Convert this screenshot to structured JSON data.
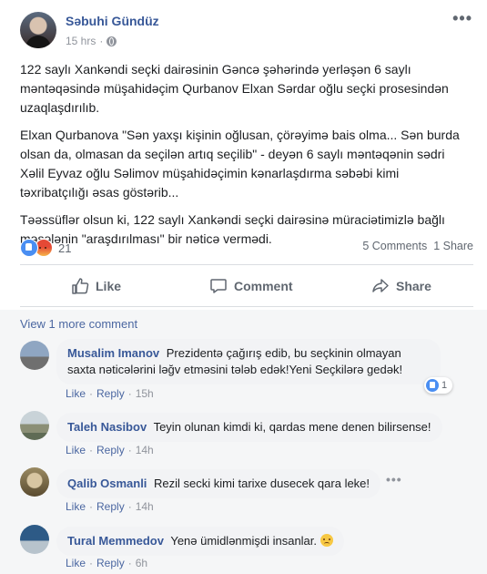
{
  "post": {
    "author": "Səbuhi Gündüz",
    "time": "15 hrs",
    "more_label": "•••",
    "paragraphs": [
      "122 saylı Xankəndi seçki dairəsinin Gəncə şəhərində yerləşən 6 saylı məntəqəsində müşahidəçim Qurbanov Elxan Sərdar oğlu seçki prosesindən uzaqlaşdırılıb.",
      "Elxan Qurbanova \"Sən yaxşı kişinin oğlusan, çörəyimə bais olma... Sən burda olsan da, olmasan da seçilən artıq seçilib\" - deyən 6 saylı məntəqənin sədri Xəlil Eyvaz oğlu Səlimov müşahidəçimin kənarlaşdırma səbəbi kimi təxribatçılığı əsas göstərib...",
      "Təəssüflər olsun ki, 122 saylı Xankəndi seçki dairəsinə müraciətimizlə bağlı məsələnin \"araşdırılması\" bir nəticə vermədi."
    ],
    "reaction_count": "21",
    "comments_count": "5 Comments",
    "shares_count": "1 Share"
  },
  "actions": {
    "like": "Like",
    "comment": "Comment",
    "share": "Share"
  },
  "comments_section": {
    "view_more": "View 1 more comment",
    "items": [
      {
        "name": "Musalim Imanov",
        "text": "Prezidentə çağırış edib, bu seçkinin olmayan saxta nəticələrini ləğv etməsini tələb edək!Yeni Seçkilərə gedək!",
        "like": "Like",
        "reply": "Reply",
        "time": "15h",
        "reaction_count": "1"
      },
      {
        "name": "Taleh Nasibov",
        "text": "Teyin olunan kimdi ki, qardas mene denen bilirsense!",
        "like": "Like",
        "reply": "Reply",
        "time": "14h"
      },
      {
        "name": "Qalib Osmanli",
        "text": "Rezil secki kimi tarixe dusecek qara leke!",
        "like": "Like",
        "reply": "Reply",
        "time": "14h"
      },
      {
        "name": "Tural Memmedov",
        "text": "Yenə ümidlənmişdi insanlar.",
        "like": "Like",
        "reply": "Reply",
        "time": "6h"
      }
    ]
  },
  "colors": {
    "name_blue": "#385898",
    "link_blue": "#4b67a1",
    "muted": "#90949c",
    "like_blue": "#4a8ef2"
  }
}
